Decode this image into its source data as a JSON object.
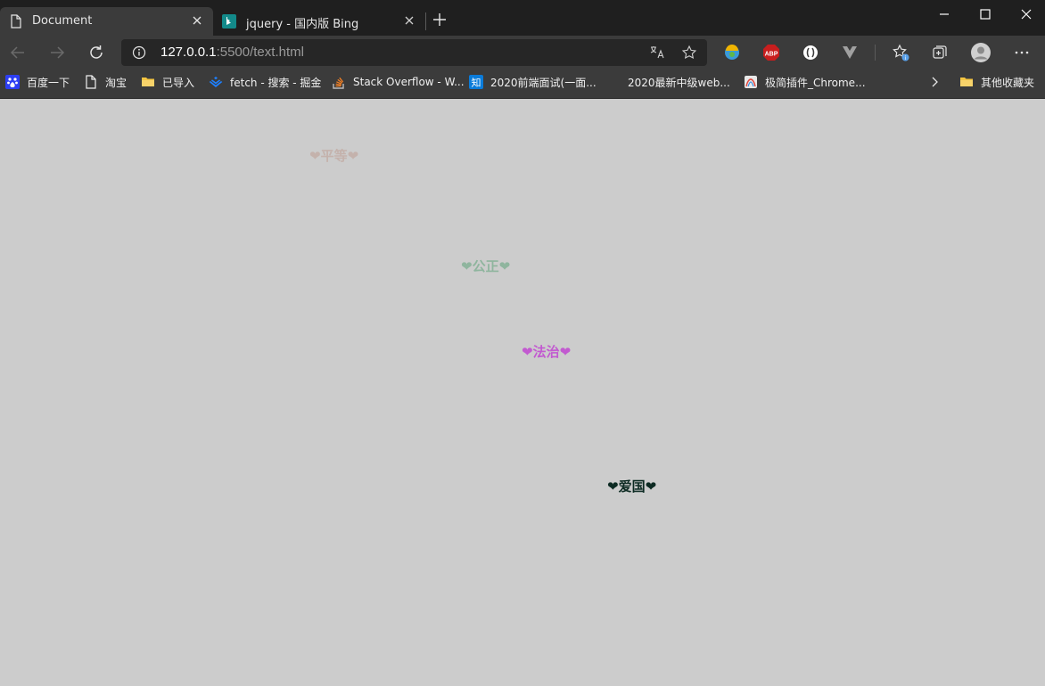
{
  "tabs": [
    {
      "title": "Document",
      "active": true,
      "icon": "document-icon"
    },
    {
      "title": "jquery - 国内版 Bing",
      "active": false,
      "icon": "bing-icon"
    }
  ],
  "toolbar": {
    "url_host": "127.0.0.1",
    "url_rest": ":5500/text.html"
  },
  "bookmarks": [
    {
      "label": "百度一下",
      "icon": "baidu-icon"
    },
    {
      "label": "淘宝",
      "icon": "page-icon"
    },
    {
      "label": "已导入",
      "icon": "folder-icon"
    },
    {
      "label": "fetch - 搜索 - 掘金",
      "icon": "juejin-icon"
    },
    {
      "label": "Stack Overflow - W...",
      "icon": "stackoverflow-icon"
    },
    {
      "label": "2020前端面试(一面...",
      "icon": "zhihu-icon"
    },
    {
      "label": "2020最新中级web...",
      "icon": ""
    },
    {
      "label": "极简插件_Chrome...",
      "icon": "extension-site-icon"
    },
    {
      "label": "其他收藏夹",
      "icon": "folder-icon"
    }
  ],
  "page": {
    "words": [
      {
        "text": "❤平等❤",
        "color": "#c4b2ac"
      },
      {
        "text": "❤公正❤",
        "color": "#8fb59e"
      },
      {
        "text": "❤法治❤",
        "color": "#c25ad0"
      },
      {
        "text": "❤爱国❤",
        "color": "#0c2a22"
      }
    ]
  },
  "colors": {
    "page_background": "#cccccc",
    "browser_chrome": "#3b3b3b",
    "title_bar": "#1f1f1f"
  }
}
